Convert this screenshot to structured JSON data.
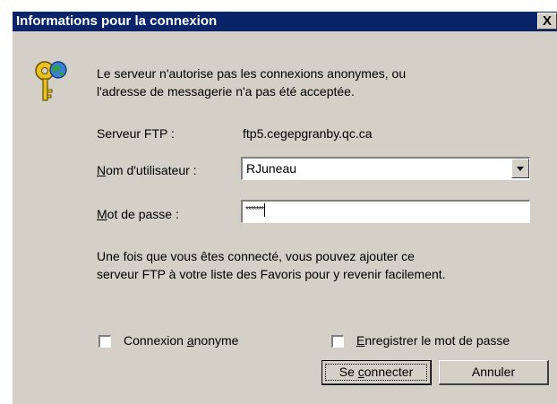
{
  "window": {
    "title": "Informations pour la connexion",
    "close_glyph": "X"
  },
  "message": {
    "line1": "Le serveur n'autorise pas les connexions anonymes, ou",
    "line2": "l'adresse de messagerie n'a pas été acceptée."
  },
  "server": {
    "label": "Serveur FTP :",
    "value": "ftp5.cegepgranby.qc.ca"
  },
  "username": {
    "label_first": "N",
    "label_rest": "om d'utilisateur :",
    "value": "RJuneau"
  },
  "password": {
    "label_first": "M",
    "label_rest": "ot de passe :",
    "masked_value": "*******"
  },
  "hint": {
    "line1": "Une fois que vous êtes connecté, vous pouvez ajouter ce",
    "line2": "serveur FTP à votre liste des Favoris pour y revenir facilement."
  },
  "anonymous": {
    "label_pre": "Connexion ",
    "label_u": "a",
    "label_post": "nonyme",
    "checked": false
  },
  "save_password": {
    "label_u": "E",
    "label_post": "nregistrer le mot de passe",
    "checked": false
  },
  "buttons": {
    "connect_pre": "Se ",
    "connect_u": "c",
    "connect_post": "onnecter",
    "cancel": "Annuler"
  },
  "icons": {
    "keys": "keys-icon",
    "dropdown": "chevron-down-icon",
    "close": "close-icon"
  }
}
